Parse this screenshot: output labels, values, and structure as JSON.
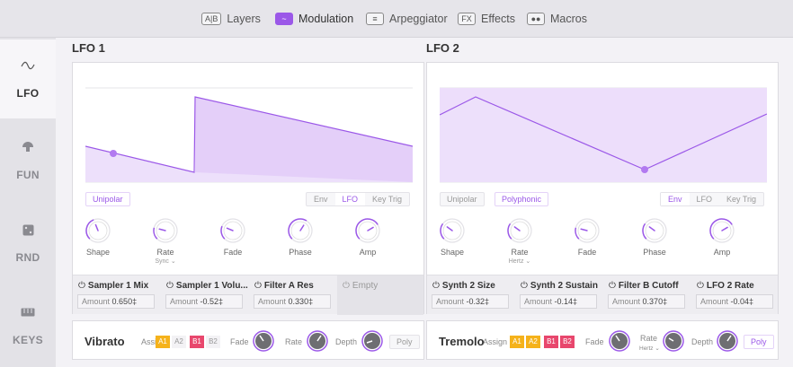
{
  "top_tabs": [
    {
      "icon": "A|B",
      "label": "Layers",
      "active": false
    },
    {
      "icon": "~",
      "label": "Modulation",
      "active": true
    },
    {
      "icon": "≡",
      "label": "Arpeggiator",
      "active": false
    },
    {
      "icon": "FX",
      "label": "Effects",
      "active": false
    },
    {
      "icon": "●●",
      "label": "Macros",
      "active": false
    }
  ],
  "sidebar": {
    "items": [
      {
        "icon": "sine-wave-icon",
        "label": "LFO",
        "active": true
      },
      {
        "icon": "mushroom-icon",
        "label": "FUN",
        "active": false
      },
      {
        "icon": "dice-icon",
        "label": "RND",
        "active": false
      },
      {
        "icon": "keyboard-icon",
        "label": "KEYS",
        "active": false
      }
    ]
  },
  "lfo1": {
    "title": "LFO 1",
    "unipolar": "Unipolar",
    "modes": [
      "Env",
      "LFO",
      "Key Trig"
    ],
    "active_mode": "LFO",
    "knobs": [
      {
        "label": "Shape",
        "sub": "",
        "value": 0.42
      },
      {
        "label": "Rate",
        "sub": "Sync ⌄",
        "value": 0.22
      },
      {
        "label": "Fade",
        "sub": "",
        "value": 0.25
      },
      {
        "label": "Phase",
        "sub": "",
        "value": 0.62
      },
      {
        "label": "Amp",
        "sub": "",
        "value": 0.72
      }
    ],
    "mods": [
      {
        "title": "Sampler 1 Mix",
        "amount_label": "Amount",
        "amount": "0.650‡"
      },
      {
        "title": "Sampler 1 Volu...",
        "amount_label": "Amount",
        "amount": "-0.52‡"
      },
      {
        "title": "Filter A Res",
        "amount_label": "Amount",
        "amount": "0.330‡"
      },
      {
        "title": "Empty",
        "amount_label": "",
        "amount": ""
      }
    ]
  },
  "lfo2": {
    "title": "LFO 2",
    "unipolar": "Unipolar",
    "polyphonic": "Polyphonic",
    "modes": [
      "Env",
      "LFO",
      "Key Trig"
    ],
    "active_mode": "Env",
    "knobs": [
      {
        "label": "Shape",
        "sub": "",
        "value": 0.3
      },
      {
        "label": "Rate",
        "sub": "Hertz ⌄",
        "value": 0.3
      },
      {
        "label": "Fade",
        "sub": "",
        "value": 0.22
      },
      {
        "label": "Phase",
        "sub": "",
        "value": 0.3
      },
      {
        "label": "Amp",
        "sub": "",
        "value": 0.72
      }
    ],
    "mods": [
      {
        "title": "Synth 2 Size",
        "amount_label": "Amount",
        "amount": "-0.32‡"
      },
      {
        "title": "Synth 2 Sustain",
        "amount_label": "Amount",
        "amount": "-0.14‡"
      },
      {
        "title": "Filter B Cutoff",
        "amount_label": "Amount",
        "amount": "0.370‡"
      },
      {
        "title": "LFO 2 Rate",
        "amount_label": "Amount",
        "amount": "-0.04‡"
      }
    ]
  },
  "vibrato": {
    "name": "Vibrato",
    "assign": "Assign",
    "tags": [
      "A1",
      "A2",
      "B1",
      "B2"
    ],
    "fade": "Fade",
    "rate": "Rate",
    "depth": "Depth",
    "poly": "Poly"
  },
  "tremolo": {
    "name": "Tremolo",
    "assign": "Assign",
    "tags": [
      "A1",
      "A2",
      "B1",
      "B2"
    ],
    "fade": "Fade",
    "rate": "Rate",
    "rate_sub": "Hertz ⌄",
    "depth": "Depth",
    "poly": "Poly"
  },
  "colors": {
    "accent": "#9b58e8",
    "tag_a": "#f5b21b",
    "tag_b": "#e8476d"
  }
}
